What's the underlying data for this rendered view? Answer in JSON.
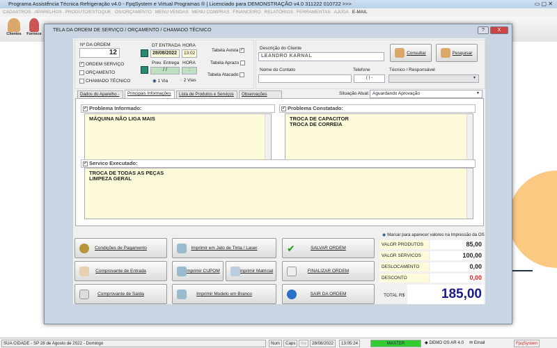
{
  "window": {
    "title": "Programa Assistência Técnica Refrigeração v4.0 - FpqSystem e Virtual Programas ® | Licenciado para  DEMONSTRAÇÃO v4.0 311222 010722 >>>"
  },
  "menu": [
    "CADASTROS",
    "APARELHOS",
    "PRODUTO/ESTOQUE",
    "OS/ORÇAMENTO",
    "MENU VENDAS",
    "MENU COMPRAS",
    "FINANCEIRO",
    "RELATÓRIOS",
    "FERRAMENTAS",
    "AJUDA"
  ],
  "menu_email": "E-MAIL",
  "toolbar": {
    "clientes": "Clientes",
    "fornece": "Fornece"
  },
  "dialog": {
    "title": "TELA DA ORDEM DE SERVIÇO / ORÇAMENTO / CHAMADO TÉCNICO",
    "help": "?",
    "close": "X"
  },
  "order": {
    "num_label": "Nº DA ORDEM",
    "num": "12",
    "types": [
      {
        "label": "ORDEM SERVIÇO",
        "checked": true
      },
      {
        "label": "ORÇAMENTO",
        "checked": false
      },
      {
        "label": "CHAMADO TÉCNICO",
        "checked": false
      }
    ],
    "dt_label": "DT ENTRADA",
    "hora_label": "HORA",
    "dt": "28/08/2022",
    "hora": "13:02",
    "prev_label": "Prev. Entrega",
    "hora2_label": "HORA",
    "prev": "/ /",
    "hora2": ":",
    "via1": "1 Via",
    "via2": "2 Vias",
    "tabelas": [
      {
        "label": "Tabela Avista",
        "checked": true
      },
      {
        "label": "Tabela Aprazo",
        "checked": false
      },
      {
        "label": "Tabela Atacado",
        "checked": false
      }
    ]
  },
  "client": {
    "desc_label": "Descrição do Cliente",
    "desc": "LEANDRO KARNAL",
    "consultar": "Consultar",
    "pesquisar": "Pesquisar",
    "contato_label": "Nome do Contato",
    "contato": "",
    "tel_label": "Telefone",
    "tel": "( )  -",
    "tecnico_label": "Técnico / Responsável",
    "tecnico": ""
  },
  "tabs": [
    "Dados do Aparelho ->",
    "Principais Informações ->",
    "Lista de Produtos e Serviços ->",
    "Observações Gerais"
  ],
  "situacao": {
    "label": "Situação Atual:",
    "value": "Aguardando Aprovação"
  },
  "sections": {
    "informado_label": "Problema Informado:",
    "informado": "MÁQUINA NÃO LIGA MAIS",
    "constatado_label": "Problema Constatado:",
    "constatado": "TROCA DE CAPACITOR\nTROCA DE CORREIA",
    "executado_label": "Servico Executado:",
    "executado": "TROCA DE TODAS AS PEÇAS\nLIMPEZA GERAL"
  },
  "buttons": {
    "pagamento": "Condições de Pagamento",
    "jato": "Imprimir em Jato de Tinta / Laser",
    "salvar": "SALVAR ORDEM",
    "entrada": "Comprovante de Entrada",
    "cupom": "Imprimir CUPOM",
    "matricial": "Imprimir Matricial",
    "finalizar": "FINALIZAR ORDEM",
    "saida": "Comprovante de Saída",
    "branco": "Imprimir Modelo em Branco",
    "sair": "SAIR DA ORDEM"
  },
  "values": {
    "marcar": "Marcar para aparecer valores na Impressão da OS",
    "rows": [
      {
        "label": "VALOR PRODUTOS",
        "value": "85,00"
      },
      {
        "label": "VALOR SERVICOS",
        "value": "100,00"
      },
      {
        "label": "DESLOCAMENTO",
        "value": "0,00"
      },
      {
        "label": "DESCONTO",
        "value": "0,00"
      }
    ],
    "total_label": "TOTAL R$",
    "total": "185,00",
    "desconto_color": "#e02020",
    "total_color": "#1a1a8c"
  },
  "status": {
    "city": "SUA CIDADE - SP 28 de Agosto de 2022 - Domingo",
    "num": "Num",
    "caps": "Caps",
    "ins": "Ins",
    "date": "28/08/2022",
    "time": "13:05:24",
    "user": "MASTER",
    "demo": "DEMO OS AR 4.0",
    "email": "Email",
    "brand": "FpqSystem"
  }
}
